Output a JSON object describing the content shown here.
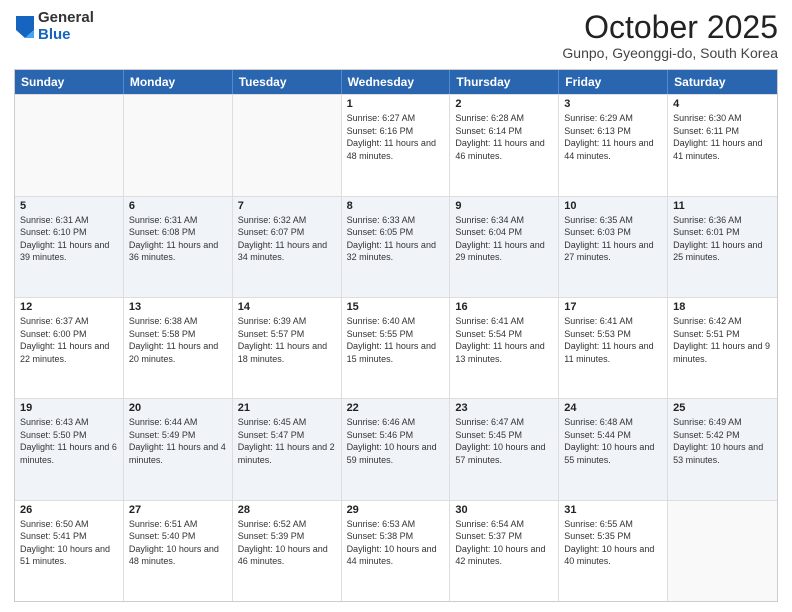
{
  "logo": {
    "general": "General",
    "blue": "Blue"
  },
  "title": "October 2025",
  "subtitle": "Gunpo, Gyeonggi-do, South Korea",
  "days": [
    "Sunday",
    "Monday",
    "Tuesday",
    "Wednesday",
    "Thursday",
    "Friday",
    "Saturday"
  ],
  "weeks": [
    [
      {
        "day": "",
        "content": ""
      },
      {
        "day": "",
        "content": ""
      },
      {
        "day": "",
        "content": ""
      },
      {
        "day": "1",
        "content": "Sunrise: 6:27 AM\nSunset: 6:16 PM\nDaylight: 11 hours and 48 minutes."
      },
      {
        "day": "2",
        "content": "Sunrise: 6:28 AM\nSunset: 6:14 PM\nDaylight: 11 hours and 46 minutes."
      },
      {
        "day": "3",
        "content": "Sunrise: 6:29 AM\nSunset: 6:13 PM\nDaylight: 11 hours and 44 minutes."
      },
      {
        "day": "4",
        "content": "Sunrise: 6:30 AM\nSunset: 6:11 PM\nDaylight: 11 hours and 41 minutes."
      }
    ],
    [
      {
        "day": "5",
        "content": "Sunrise: 6:31 AM\nSunset: 6:10 PM\nDaylight: 11 hours and 39 minutes."
      },
      {
        "day": "6",
        "content": "Sunrise: 6:31 AM\nSunset: 6:08 PM\nDaylight: 11 hours and 36 minutes."
      },
      {
        "day": "7",
        "content": "Sunrise: 6:32 AM\nSunset: 6:07 PM\nDaylight: 11 hours and 34 minutes."
      },
      {
        "day": "8",
        "content": "Sunrise: 6:33 AM\nSunset: 6:05 PM\nDaylight: 11 hours and 32 minutes."
      },
      {
        "day": "9",
        "content": "Sunrise: 6:34 AM\nSunset: 6:04 PM\nDaylight: 11 hours and 29 minutes."
      },
      {
        "day": "10",
        "content": "Sunrise: 6:35 AM\nSunset: 6:03 PM\nDaylight: 11 hours and 27 minutes."
      },
      {
        "day": "11",
        "content": "Sunrise: 6:36 AM\nSunset: 6:01 PM\nDaylight: 11 hours and 25 minutes."
      }
    ],
    [
      {
        "day": "12",
        "content": "Sunrise: 6:37 AM\nSunset: 6:00 PM\nDaylight: 11 hours and 22 minutes."
      },
      {
        "day": "13",
        "content": "Sunrise: 6:38 AM\nSunset: 5:58 PM\nDaylight: 11 hours and 20 minutes."
      },
      {
        "day": "14",
        "content": "Sunrise: 6:39 AM\nSunset: 5:57 PM\nDaylight: 11 hours and 18 minutes."
      },
      {
        "day": "15",
        "content": "Sunrise: 6:40 AM\nSunset: 5:55 PM\nDaylight: 11 hours and 15 minutes."
      },
      {
        "day": "16",
        "content": "Sunrise: 6:41 AM\nSunset: 5:54 PM\nDaylight: 11 hours and 13 minutes."
      },
      {
        "day": "17",
        "content": "Sunrise: 6:41 AM\nSunset: 5:53 PM\nDaylight: 11 hours and 11 minutes."
      },
      {
        "day": "18",
        "content": "Sunrise: 6:42 AM\nSunset: 5:51 PM\nDaylight: 11 hours and 9 minutes."
      }
    ],
    [
      {
        "day": "19",
        "content": "Sunrise: 6:43 AM\nSunset: 5:50 PM\nDaylight: 11 hours and 6 minutes."
      },
      {
        "day": "20",
        "content": "Sunrise: 6:44 AM\nSunset: 5:49 PM\nDaylight: 11 hours and 4 minutes."
      },
      {
        "day": "21",
        "content": "Sunrise: 6:45 AM\nSunset: 5:47 PM\nDaylight: 11 hours and 2 minutes."
      },
      {
        "day": "22",
        "content": "Sunrise: 6:46 AM\nSunset: 5:46 PM\nDaylight: 10 hours and 59 minutes."
      },
      {
        "day": "23",
        "content": "Sunrise: 6:47 AM\nSunset: 5:45 PM\nDaylight: 10 hours and 57 minutes."
      },
      {
        "day": "24",
        "content": "Sunrise: 6:48 AM\nSunset: 5:44 PM\nDaylight: 10 hours and 55 minutes."
      },
      {
        "day": "25",
        "content": "Sunrise: 6:49 AM\nSunset: 5:42 PM\nDaylight: 10 hours and 53 minutes."
      }
    ],
    [
      {
        "day": "26",
        "content": "Sunrise: 6:50 AM\nSunset: 5:41 PM\nDaylight: 10 hours and 51 minutes."
      },
      {
        "day": "27",
        "content": "Sunrise: 6:51 AM\nSunset: 5:40 PM\nDaylight: 10 hours and 48 minutes."
      },
      {
        "day": "28",
        "content": "Sunrise: 6:52 AM\nSunset: 5:39 PM\nDaylight: 10 hours and 46 minutes."
      },
      {
        "day": "29",
        "content": "Sunrise: 6:53 AM\nSunset: 5:38 PM\nDaylight: 10 hours and 44 minutes."
      },
      {
        "day": "30",
        "content": "Sunrise: 6:54 AM\nSunset: 5:37 PM\nDaylight: 10 hours and 42 minutes."
      },
      {
        "day": "31",
        "content": "Sunrise: 6:55 AM\nSunset: 5:35 PM\nDaylight: 10 hours and 40 minutes."
      },
      {
        "day": "",
        "content": ""
      }
    ]
  ]
}
